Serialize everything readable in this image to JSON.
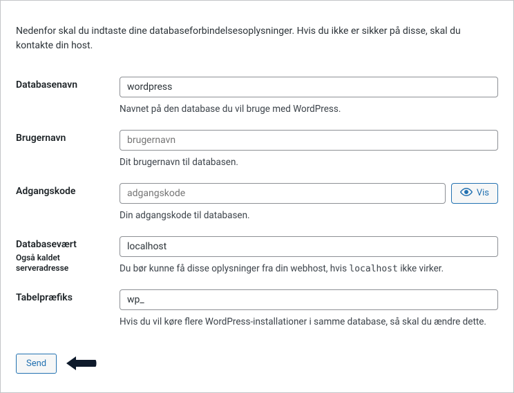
{
  "intro": "Nedenfor skal du indtaste dine databaseforbindelsesoplysninger. Hvis du ikke er sikker på disse, skal du kontakte din host.",
  "fields": {
    "dbname": {
      "label": "Databasenavn",
      "value": "wordpress",
      "description": "Navnet på den database du vil bruge med WordPress."
    },
    "username": {
      "label": "Brugernavn",
      "placeholder": "brugernavn",
      "value": "",
      "description": "Dit brugernavn til databasen."
    },
    "password": {
      "label": "Adgangskode",
      "placeholder": "adgangskode",
      "value": "",
      "show_label": "Vis",
      "description": "Din adgangskode til databasen."
    },
    "dbhost": {
      "label": "Databasevært",
      "sublabel": "Også kaldet serveradresse",
      "value": "localhost",
      "description_pre": "Du bør kunne få disse oplysninger fra din webhost, hvis ",
      "description_code": "localhost",
      "description_post": " ikke virker."
    },
    "prefix": {
      "label": "Tabelpræfiks",
      "value": "wp_",
      "description": "Hvis du vil køre flere WordPress-installationer i samme database, så skal du ændre dette."
    }
  },
  "submit_label": "Send"
}
